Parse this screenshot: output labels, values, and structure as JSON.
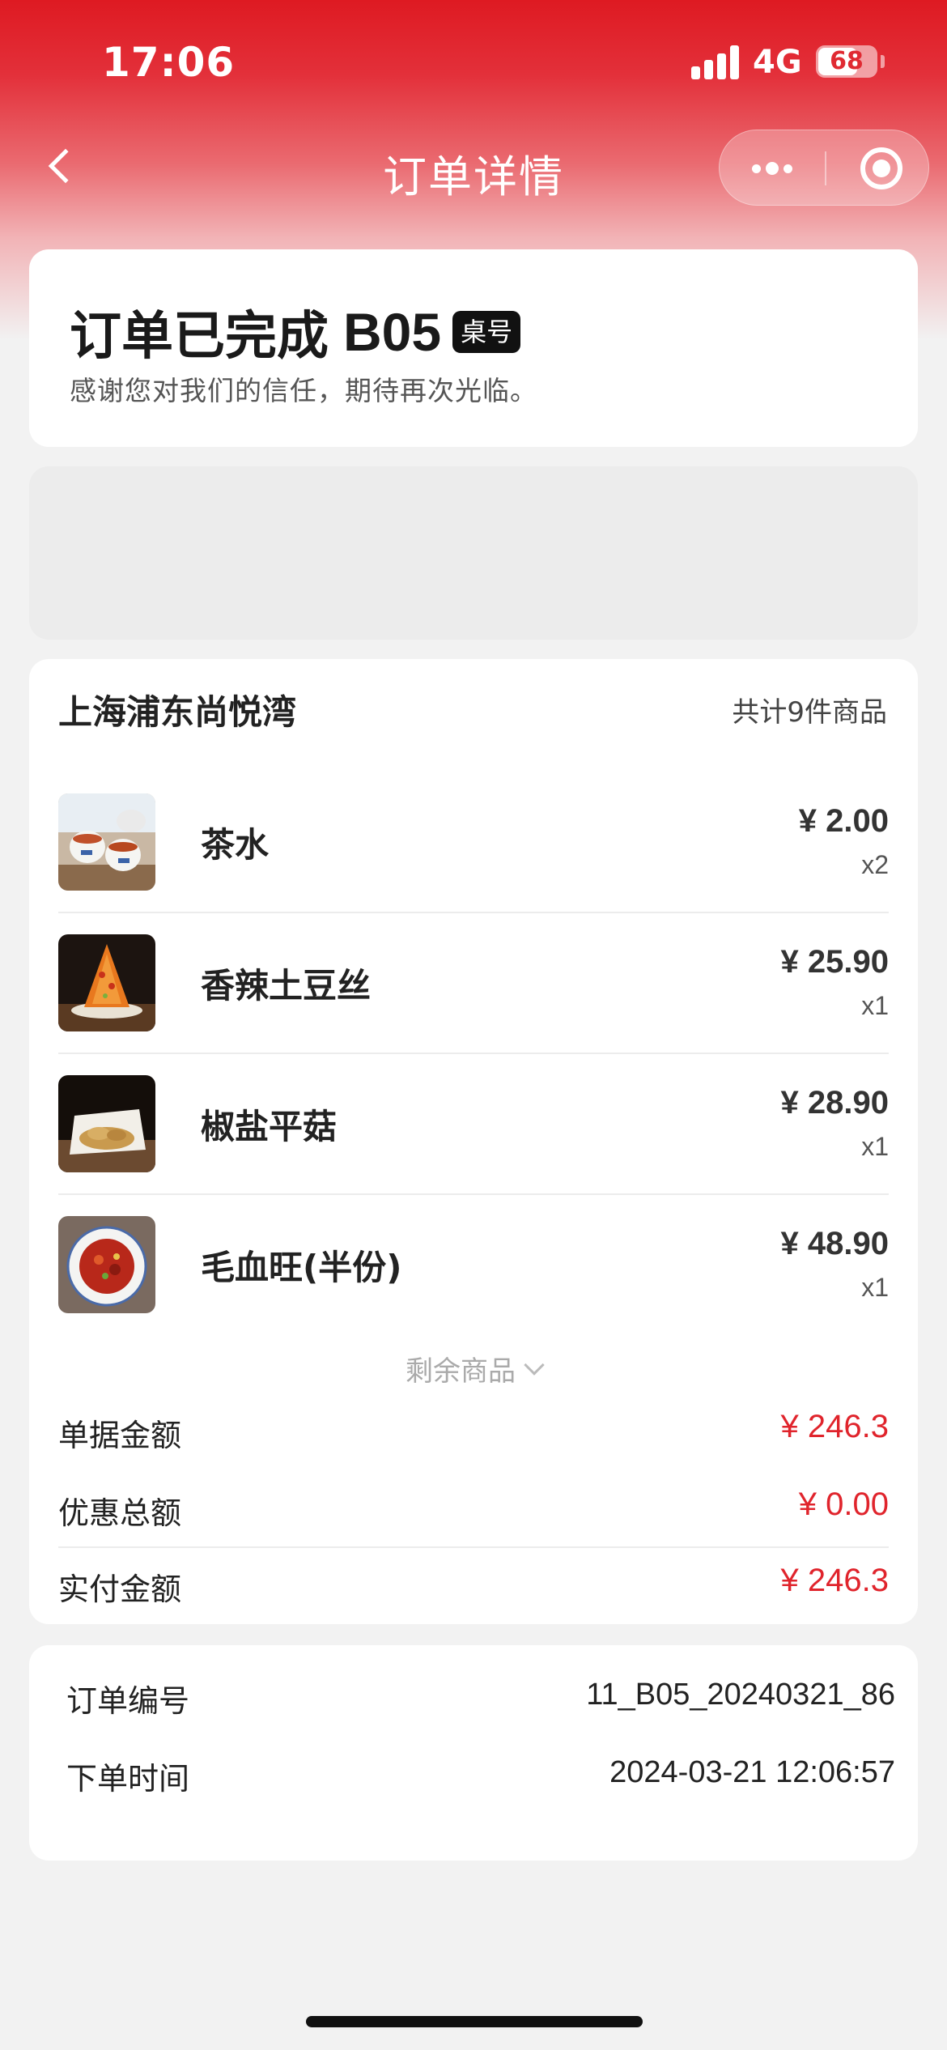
{
  "status_bar": {
    "time": "17:06",
    "network": "4G",
    "battery": "68"
  },
  "nav": {
    "title": "订单详情",
    "back_icon": "chevron-left-icon",
    "more_icon": "more-dots-icon",
    "close_icon": "target-circle-icon"
  },
  "order_status": {
    "title": "订单已完成",
    "table_code": "B05",
    "table_badge": "桌号",
    "message": "感谢您对我们的信任，期待再次光临。"
  },
  "store": {
    "name": "上海浦东尚悦湾",
    "item_count_text": "共计9件商品"
  },
  "items": [
    {
      "name": "茶水",
      "price": "¥ 2.00",
      "qty": "x2",
      "image": "tea-cups-image"
    },
    {
      "name": "香辣土豆丝",
      "price": "¥ 25.90",
      "qty": "x1",
      "image": "shredded-potato-image"
    },
    {
      "name": "椒盐平菇",
      "price": "¥ 28.90",
      "qty": "x1",
      "image": "fried-mushroom-image"
    },
    {
      "name": "毛血旺(半份)",
      "price": "¥ 48.90",
      "qty": "x1",
      "image": "spicy-stew-image"
    }
  ],
  "more_items_label": "剩余商品",
  "summary": [
    {
      "label": "单据金额",
      "value": "¥ 246.3"
    },
    {
      "label": "优惠总额",
      "value": "¥ 0.00"
    },
    {
      "label": "实付金额",
      "value": "¥ 246.3"
    }
  ],
  "order_info": [
    {
      "label": "订单编号",
      "value": "11_B05_20240321_86"
    },
    {
      "label": "下单时间",
      "value": "2024-03-21 12:06:57"
    }
  ],
  "colors": {
    "brand_red": "#de1a22",
    "price_red": "#e0242c"
  }
}
